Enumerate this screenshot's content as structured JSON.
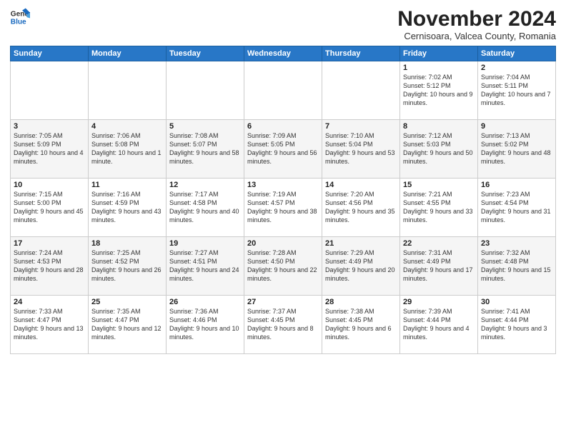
{
  "logo": {
    "general": "General",
    "blue": "Blue"
  },
  "title": "November 2024",
  "location": "Cernisoara, Valcea County, Romania",
  "headers": [
    "Sunday",
    "Monday",
    "Tuesday",
    "Wednesday",
    "Thursday",
    "Friday",
    "Saturday"
  ],
  "rows": [
    [
      {
        "day": "",
        "info": ""
      },
      {
        "day": "",
        "info": ""
      },
      {
        "day": "",
        "info": ""
      },
      {
        "day": "",
        "info": ""
      },
      {
        "day": "",
        "info": ""
      },
      {
        "day": "1",
        "info": "Sunrise: 7:02 AM\nSunset: 5:12 PM\nDaylight: 10 hours and 9 minutes."
      },
      {
        "day": "2",
        "info": "Sunrise: 7:04 AM\nSunset: 5:11 PM\nDaylight: 10 hours and 7 minutes."
      }
    ],
    [
      {
        "day": "3",
        "info": "Sunrise: 7:05 AM\nSunset: 5:09 PM\nDaylight: 10 hours and 4 minutes."
      },
      {
        "day": "4",
        "info": "Sunrise: 7:06 AM\nSunset: 5:08 PM\nDaylight: 10 hours and 1 minute."
      },
      {
        "day": "5",
        "info": "Sunrise: 7:08 AM\nSunset: 5:07 PM\nDaylight: 9 hours and 58 minutes."
      },
      {
        "day": "6",
        "info": "Sunrise: 7:09 AM\nSunset: 5:05 PM\nDaylight: 9 hours and 56 minutes."
      },
      {
        "day": "7",
        "info": "Sunrise: 7:10 AM\nSunset: 5:04 PM\nDaylight: 9 hours and 53 minutes."
      },
      {
        "day": "8",
        "info": "Sunrise: 7:12 AM\nSunset: 5:03 PM\nDaylight: 9 hours and 50 minutes."
      },
      {
        "day": "9",
        "info": "Sunrise: 7:13 AM\nSunset: 5:02 PM\nDaylight: 9 hours and 48 minutes."
      }
    ],
    [
      {
        "day": "10",
        "info": "Sunrise: 7:15 AM\nSunset: 5:00 PM\nDaylight: 9 hours and 45 minutes."
      },
      {
        "day": "11",
        "info": "Sunrise: 7:16 AM\nSunset: 4:59 PM\nDaylight: 9 hours and 43 minutes."
      },
      {
        "day": "12",
        "info": "Sunrise: 7:17 AM\nSunset: 4:58 PM\nDaylight: 9 hours and 40 minutes."
      },
      {
        "day": "13",
        "info": "Sunrise: 7:19 AM\nSunset: 4:57 PM\nDaylight: 9 hours and 38 minutes."
      },
      {
        "day": "14",
        "info": "Sunrise: 7:20 AM\nSunset: 4:56 PM\nDaylight: 9 hours and 35 minutes."
      },
      {
        "day": "15",
        "info": "Sunrise: 7:21 AM\nSunset: 4:55 PM\nDaylight: 9 hours and 33 minutes."
      },
      {
        "day": "16",
        "info": "Sunrise: 7:23 AM\nSunset: 4:54 PM\nDaylight: 9 hours and 31 minutes."
      }
    ],
    [
      {
        "day": "17",
        "info": "Sunrise: 7:24 AM\nSunset: 4:53 PM\nDaylight: 9 hours and 28 minutes."
      },
      {
        "day": "18",
        "info": "Sunrise: 7:25 AM\nSunset: 4:52 PM\nDaylight: 9 hours and 26 minutes."
      },
      {
        "day": "19",
        "info": "Sunrise: 7:27 AM\nSunset: 4:51 PM\nDaylight: 9 hours and 24 minutes."
      },
      {
        "day": "20",
        "info": "Sunrise: 7:28 AM\nSunset: 4:50 PM\nDaylight: 9 hours and 22 minutes."
      },
      {
        "day": "21",
        "info": "Sunrise: 7:29 AM\nSunset: 4:49 PM\nDaylight: 9 hours and 20 minutes."
      },
      {
        "day": "22",
        "info": "Sunrise: 7:31 AM\nSunset: 4:49 PM\nDaylight: 9 hours and 17 minutes."
      },
      {
        "day": "23",
        "info": "Sunrise: 7:32 AM\nSunset: 4:48 PM\nDaylight: 9 hours and 15 minutes."
      }
    ],
    [
      {
        "day": "24",
        "info": "Sunrise: 7:33 AM\nSunset: 4:47 PM\nDaylight: 9 hours and 13 minutes."
      },
      {
        "day": "25",
        "info": "Sunrise: 7:35 AM\nSunset: 4:47 PM\nDaylight: 9 hours and 12 minutes."
      },
      {
        "day": "26",
        "info": "Sunrise: 7:36 AM\nSunset: 4:46 PM\nDaylight: 9 hours and 10 minutes."
      },
      {
        "day": "27",
        "info": "Sunrise: 7:37 AM\nSunset: 4:45 PM\nDaylight: 9 hours and 8 minutes."
      },
      {
        "day": "28",
        "info": "Sunrise: 7:38 AM\nSunset: 4:45 PM\nDaylight: 9 hours and 6 minutes."
      },
      {
        "day": "29",
        "info": "Sunrise: 7:39 AM\nSunset: 4:44 PM\nDaylight: 9 hours and 4 minutes."
      },
      {
        "day": "30",
        "info": "Sunrise: 7:41 AM\nSunset: 4:44 PM\nDaylight: 9 hours and 3 minutes."
      }
    ]
  ]
}
